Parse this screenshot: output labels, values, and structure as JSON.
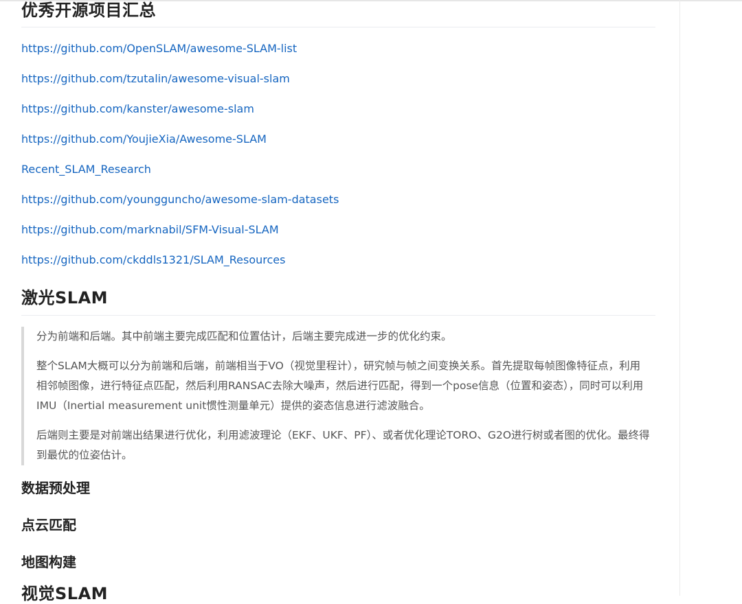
{
  "section_open_source": {
    "title": "优秀开源项目汇总",
    "links": [
      "https://github.com/OpenSLAM/awesome-SLAM-list",
      "https://github.com/tzutalin/awesome-visual-slam",
      "https://github.com/kanster/awesome-slam",
      "https://github.com/YoujieXia/Awesome-SLAM",
      "Recent_SLAM_Research",
      "https://github.com/youngguncho/awesome-slam-datasets",
      "https://github.com/marknabil/SFM-Visual-SLAM",
      "https://github.com/ckddls1321/SLAM_Resources"
    ]
  },
  "section_laser": {
    "title": "激光SLAM",
    "quote": [
      "分为前端和后端。其中前端主要完成匹配和位置估计，后端主要完成进一步的优化约束。",
      "整个SLAM大概可以分为前端和后端，前端相当于VO（视觉里程计），研究帧与帧之间变换关系。首先提取每帧图像特征点，利用相邻帧图像，进行特征点匹配，然后利用RANSAC去除大噪声，然后进行匹配，得到一个pose信息（位置和姿态），同时可以利用IMU（Inertial measurement unit惯性测量单元）提供的姿态信息进行滤波融合。",
      "后端则主要是对前端出结果进行优化，利用滤波理论（EKF、UKF、PF）、或者优化理论TORO、G2O进行树或者图的优化。最终得到最优的位姿估计。"
    ],
    "subheadings": [
      "数据预处理",
      "点云匹配",
      "地图构建"
    ]
  },
  "section_visual": {
    "title": "视觉SLAM"
  },
  "colors": {
    "link": "#1565c0",
    "heading": "#222222",
    "quote_text": "#555555",
    "quote_border": "#d8d8d8"
  }
}
